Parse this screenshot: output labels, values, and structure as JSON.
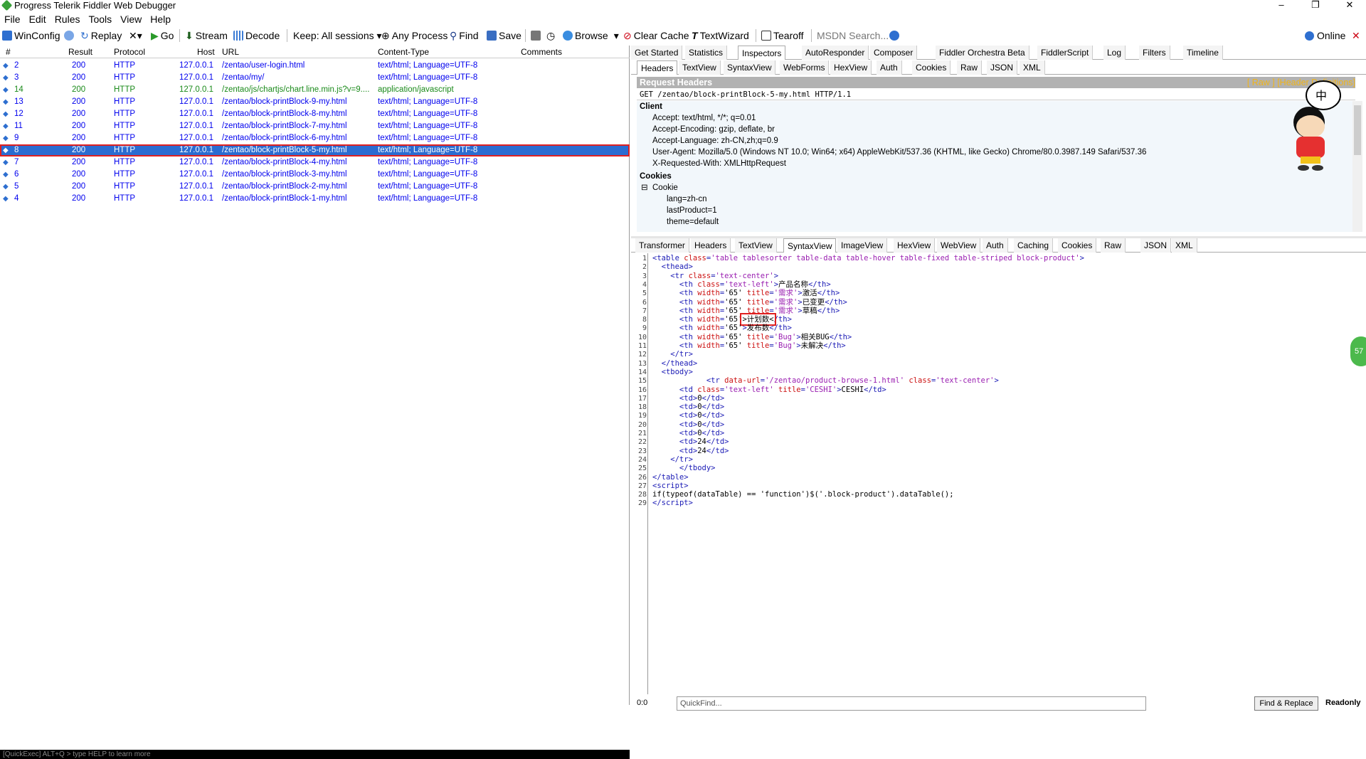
{
  "window": {
    "title": "Progress Telerik Fiddler Web Debugger"
  },
  "menu": [
    "File",
    "Edit",
    "Rules",
    "Tools",
    "View",
    "Help"
  ],
  "toolbar": {
    "winconfig": "WinConfig",
    "replay": "Replay",
    "x": "✕▾",
    "go": "Go",
    "stream": "Stream",
    "decode": "Decode",
    "keep": "Keep: All sessions ▾",
    "any_process": "Any Process",
    "find": "Find",
    "save": "Save",
    "browse": "Browse",
    "clear_cache": "Clear Cache",
    "textwizard": "TextWizard",
    "tearoff": "Tearoff",
    "msdn_search": "MSDN Search...",
    "online": "Online"
  },
  "sessions": {
    "headers": {
      "num": "#",
      "result": "Result",
      "protocol": "Protocol",
      "host": "Host",
      "url": "URL",
      "content_type": "Content-Type",
      "comments": "Comments"
    },
    "rows": [
      {
        "id": "2",
        "result": "200",
        "protocol": "HTTP",
        "host": "127.0.0.1",
        "url": "/zentao/user-login.html",
        "content_type": "text/html; Language=UTF-8"
      },
      {
        "id": "3",
        "result": "200",
        "protocol": "HTTP",
        "host": "127.0.0.1",
        "url": "/zentao/my/",
        "content_type": "text/html; Language=UTF-8"
      },
      {
        "id": "14",
        "result": "200",
        "protocol": "HTTP",
        "host": "127.0.0.1",
        "url": "/zentao/js/chartjs/chart.line.min.js?v=9....",
        "content_type": "application/javascript"
      },
      {
        "id": "13",
        "result": "200",
        "protocol": "HTTP",
        "host": "127.0.0.1",
        "url": "/zentao/block-printBlock-9-my.html",
        "content_type": "text/html; Language=UTF-8"
      },
      {
        "id": "12",
        "result": "200",
        "protocol": "HTTP",
        "host": "127.0.0.1",
        "url": "/zentao/block-printBlock-8-my.html",
        "content_type": "text/html; Language=UTF-8"
      },
      {
        "id": "11",
        "result": "200",
        "protocol": "HTTP",
        "host": "127.0.0.1",
        "url": "/zentao/block-printBlock-7-my.html",
        "content_type": "text/html; Language=UTF-8"
      },
      {
        "id": "9",
        "result": "200",
        "protocol": "HTTP",
        "host": "127.0.0.1",
        "url": "/zentao/block-printBlock-6-my.html",
        "content_type": "text/html; Language=UTF-8"
      },
      {
        "id": "8",
        "result": "200",
        "protocol": "HTTP",
        "host": "127.0.0.1",
        "url": "/zentao/block-printBlock-5-my.html",
        "content_type": "text/html; Language=UTF-8"
      },
      {
        "id": "7",
        "result": "200",
        "protocol": "HTTP",
        "host": "127.0.0.1",
        "url": "/zentao/block-printBlock-4-my.html",
        "content_type": "text/html; Language=UTF-8"
      },
      {
        "id": "6",
        "result": "200",
        "protocol": "HTTP",
        "host": "127.0.0.1",
        "url": "/zentao/block-printBlock-3-my.html",
        "content_type": "text/html; Language=UTF-8"
      },
      {
        "id": "5",
        "result": "200",
        "protocol": "HTTP",
        "host": "127.0.0.1",
        "url": "/zentao/block-printBlock-2-my.html",
        "content_type": "text/html; Language=UTF-8"
      },
      {
        "id": "4",
        "result": "200",
        "protocol": "HTTP",
        "host": "127.0.0.1",
        "url": "/zentao/block-printBlock-1-my.html",
        "content_type": "text/html; Language=UTF-8"
      }
    ],
    "quickexec": "[QuickExec] ALT+Q > type HELP to learn more"
  },
  "inspector_tabs": [
    "Get Started",
    "Statistics",
    "Inspectors",
    "AutoResponder",
    "Composer",
    "Fiddler Orchestra Beta",
    "FiddlerScript",
    "Log",
    "Filters",
    "Timeline"
  ],
  "request_tabs": [
    "Headers",
    "TextView",
    "SyntaxView",
    "WebForms",
    "HexView",
    "Auth",
    "Cookies",
    "Raw",
    "JSON",
    "XML"
  ],
  "request": {
    "title": "Request Headers",
    "raw_links": "[ Raw ]   [Header Definitions]",
    "line": "GET /zentao/block-printBlock-5-my.html HTTP/1.1",
    "client_label": "Client",
    "client": [
      "Accept: text/html, */*; q=0.01",
      "Accept-Encoding: gzip, deflate, br",
      "Accept-Language: zh-CN,zh;q=0.9",
      "User-Agent: Mozilla/5.0 (Windows NT 10.0; Win64; x64) AppleWebKit/537.36 (KHTML, like Gecko) Chrome/80.0.3987.149 Safari/537.36",
      "X-Requested-With: XMLHttpRequest"
    ],
    "cookies_label": "Cookies",
    "cookie_label": "Cookie",
    "cookies": [
      "lang=zh-cn",
      "lastProduct=1",
      "theme=default"
    ]
  },
  "response_tabs": [
    "Transformer",
    "Headers",
    "TextView",
    "SyntaxView",
    "ImageView",
    "HexView",
    "WebView",
    "Auth",
    "Caching",
    "Cookies",
    "Raw",
    "JSON",
    "XML"
  ],
  "status": {
    "position": "0:0",
    "quickfind": "QuickFind...",
    "find_replace": "Find & Replace",
    "ready": "Readonly"
  },
  "badge": "57",
  "colors": {
    "selection": "#2b6cd1",
    "highlight": "#e02020",
    "link": "#0000ee",
    "tag": "#1a1ab5",
    "attr": "#cc1010",
    "string": "#9a1fb1"
  }
}
